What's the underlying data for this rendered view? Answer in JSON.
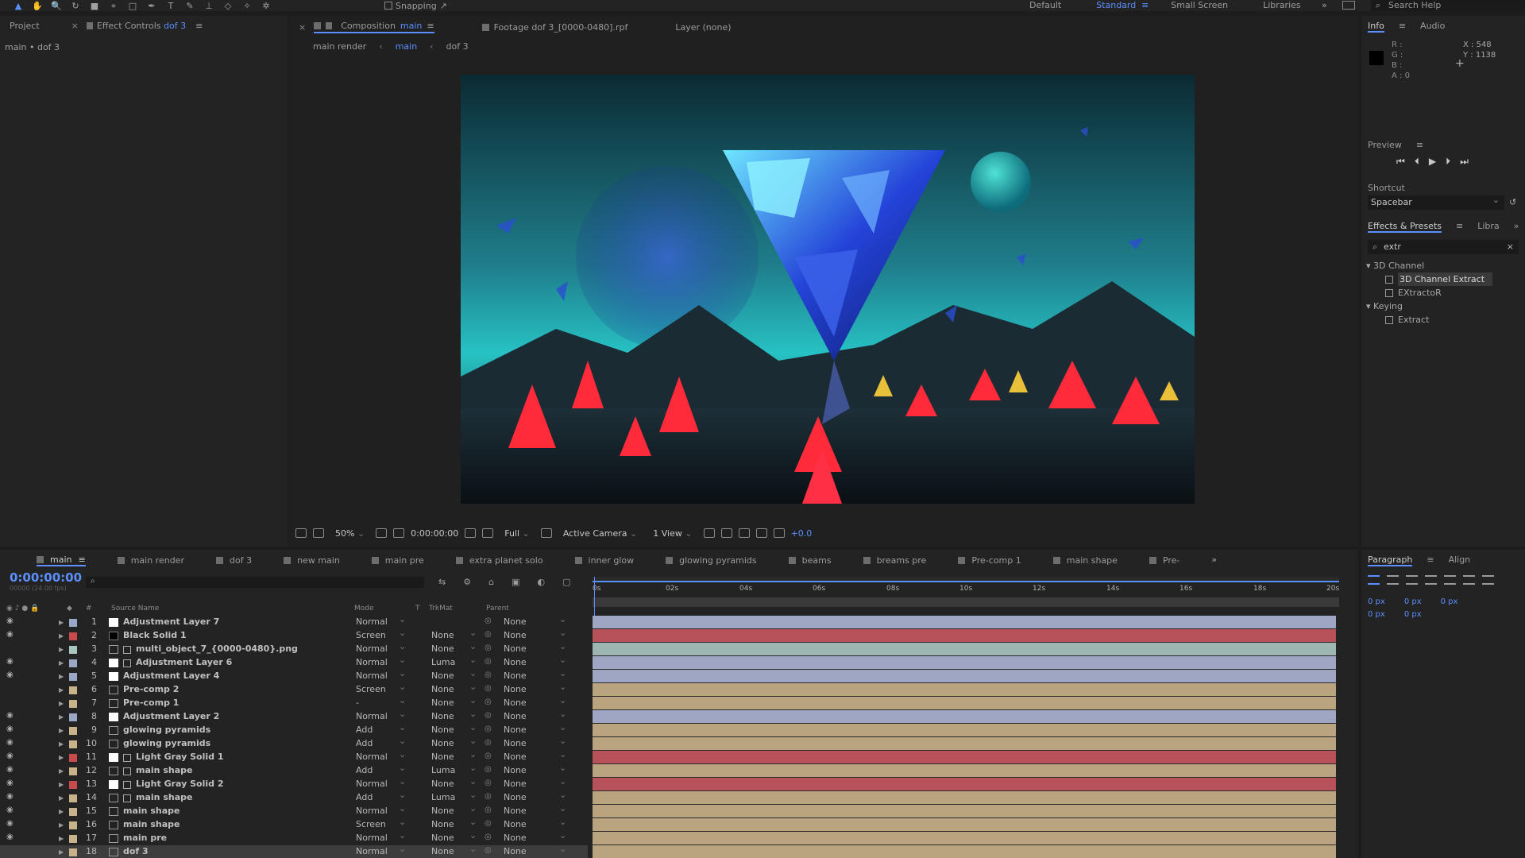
{
  "toolbar": {
    "snapping": "Snapping",
    "workspaces": [
      "Default",
      "Standard",
      "Small Screen",
      "Libraries"
    ],
    "active_workspace": "Standard",
    "search_placeholder": "Search Help"
  },
  "project_panel": {
    "tab_project": "Project",
    "tab_effect_controls": "Effect Controls",
    "effect_controls_target": "dof 3",
    "breadcrumb": "main • dof 3"
  },
  "composition": {
    "tab_label": "Composition",
    "tab_name": "main",
    "footage_tab": "Footage dof 3_[0000-0480].rpf",
    "layer_tab": "Layer (none)",
    "breadcrumb": [
      "main render",
      "main",
      "dof 3"
    ],
    "viewer": {
      "zoom": "50%",
      "time": "0:00:00:00",
      "resolution": "Full",
      "camera": "Active Camera",
      "views": "1 View",
      "exposure": "+0.0"
    }
  },
  "info_panel": {
    "tabs": [
      "Info",
      "Audio"
    ],
    "r": "R :",
    "g": "G :",
    "b": "B :",
    "a": "A : 0",
    "x": "X : 548",
    "y": "Y : 1138"
  },
  "preview_panel": {
    "title": "Preview",
    "shortcut_label": "Shortcut",
    "shortcut_value": "Spacebar"
  },
  "effects_panel": {
    "tabs": [
      "Effects & Presets",
      "Libra"
    ],
    "search": "extr",
    "groups": [
      {
        "name": "3D Channel",
        "items": [
          "3D Channel Extract",
          "EXtractoR"
        ]
      },
      {
        "name": "Keying",
        "items": [
          "Extract"
        ]
      }
    ],
    "selected_item": "3D Channel Extract"
  },
  "timeline": {
    "tabs": [
      "main",
      "main render",
      "dof 3",
      "new main",
      "main pre",
      "extra planet solo",
      "inner glow",
      "glowing pyramids",
      "beams",
      "breams pre",
      "Pre-comp 1",
      "main shape",
      "Pre-"
    ],
    "active_tab": "main",
    "timecode": "0:00:00:00",
    "timecode_sub": "00000 (24.00 fps)",
    "columns": {
      "num": "#",
      "source": "Source Name",
      "mode": "Mode",
      "t": "T",
      "trkmat": "TrkMat",
      "parent": "Parent"
    },
    "ruler_ticks": [
      "0s",
      "02s",
      "04s",
      "06s",
      "08s",
      "10s",
      "12s",
      "14s",
      "16s",
      "18s",
      "20s"
    ],
    "layers": [
      {
        "num": "1",
        "name": "Adjustment Layer 7",
        "mode": "Normal",
        "trkmat": "",
        "parent": "None",
        "label": "#9aa7c7",
        "icon": "solid",
        "fx": false,
        "eye": true,
        "bar": "#9fa6c4"
      },
      {
        "num": "2",
        "name": "Black Solid 1",
        "mode": "Screen",
        "trkmat": "None",
        "parent": "None",
        "label": "#c84a4a",
        "icon": "black",
        "fx": false,
        "eye": true,
        "bar": "#b8525a"
      },
      {
        "num": "3",
        "name": "multi_object_7_{0000-0480}.png",
        "mode": "Normal",
        "trkmat": "None",
        "parent": "None",
        "label": "#a9c5c1",
        "icon": "footage",
        "fx": true,
        "eye": false,
        "bar": "#9eb6b2"
      },
      {
        "num": "4",
        "name": "Adjustment Layer 6",
        "mode": "Normal",
        "trkmat": "Luma",
        "parent": "None",
        "label": "#9aa7c7",
        "icon": "solid",
        "fx": true,
        "eye": true,
        "bar": "#9fa6c4"
      },
      {
        "num": "5",
        "name": "Adjustment Layer 4",
        "mode": "Normal",
        "trkmat": "None",
        "parent": "None",
        "label": "#9aa7c7",
        "icon": "solid",
        "fx": false,
        "eye": true,
        "bar": "#9fa6c4"
      },
      {
        "num": "6",
        "name": "Pre-comp 2",
        "mode": "Screen",
        "trkmat": "None",
        "parent": "None",
        "label": "#c7b28a",
        "icon": "comp",
        "fx": false,
        "eye": false,
        "bar": "#b9a47f"
      },
      {
        "num": "7",
        "name": "Pre-comp 1",
        "mode": "-",
        "trkmat": "None",
        "parent": "None",
        "label": "#c7b28a",
        "icon": "comp",
        "fx": false,
        "eye": false,
        "bar": "#b9a47f"
      },
      {
        "num": "8",
        "name": "Adjustment Layer 2",
        "mode": "Normal",
        "trkmat": "None",
        "parent": "None",
        "label": "#9aa7c7",
        "icon": "solid",
        "fx": false,
        "eye": true,
        "bar": "#9fa6c4"
      },
      {
        "num": "9",
        "name": "glowing pyramids",
        "mode": "Add",
        "trkmat": "None",
        "parent": "None",
        "label": "#c7b28a",
        "icon": "comp",
        "fx": false,
        "eye": true,
        "bar": "#b9a47f"
      },
      {
        "num": "10",
        "name": "glowing pyramids",
        "mode": "Add",
        "trkmat": "None",
        "parent": "None",
        "label": "#c7b28a",
        "icon": "comp",
        "fx": false,
        "eye": true,
        "bar": "#b9a47f"
      },
      {
        "num": "11",
        "name": "Light Gray Solid 1",
        "mode": "Normal",
        "trkmat": "None",
        "parent": "None",
        "label": "#c84a4a",
        "icon": "solid",
        "fx": true,
        "eye": true,
        "bar": "#b8525a"
      },
      {
        "num": "12",
        "name": "main shape",
        "mode": "Add",
        "trkmat": "Luma",
        "parent": "None",
        "label": "#c7b28a",
        "icon": "comp",
        "fx": true,
        "eye": true,
        "bar": "#b9a47f"
      },
      {
        "num": "13",
        "name": "Light Gray Solid 2",
        "mode": "Normal",
        "trkmat": "None",
        "parent": "None",
        "label": "#c84a4a",
        "icon": "solid",
        "fx": true,
        "eye": true,
        "bar": "#b8525a"
      },
      {
        "num": "14",
        "name": "main shape",
        "mode": "Add",
        "trkmat": "Luma",
        "parent": "None",
        "label": "#c7b28a",
        "icon": "comp",
        "fx": true,
        "eye": true,
        "bar": "#b9a47f"
      },
      {
        "num": "15",
        "name": "main shape",
        "mode": "Normal",
        "trkmat": "None",
        "parent": "None",
        "label": "#c7b28a",
        "icon": "comp",
        "fx": false,
        "eye": true,
        "bar": "#b9a47f"
      },
      {
        "num": "16",
        "name": "main shape",
        "mode": "Screen",
        "trkmat": "None",
        "parent": "None",
        "label": "#c7b28a",
        "icon": "comp",
        "fx": false,
        "eye": true,
        "bar": "#b9a47f"
      },
      {
        "num": "17",
        "name": "main pre",
        "mode": "Normal",
        "trkmat": "None",
        "parent": "None",
        "label": "#c7b28a",
        "icon": "comp",
        "fx": false,
        "eye": true,
        "bar": "#b9a47f"
      },
      {
        "num": "18",
        "name": "dof 3",
        "mode": "Normal",
        "trkmat": "None",
        "parent": "None",
        "label": "#c7b28a",
        "icon": "comp",
        "fx": false,
        "eye": false,
        "bar": "#b9a47f",
        "selected": true
      }
    ]
  },
  "paragraph_panel": {
    "tabs": [
      "Paragraph",
      "Align"
    ],
    "indent_left": "0 px",
    "indent_first": "0 px",
    "indent_right": "0 px",
    "space_before": "0 px",
    "space_after": "0 px"
  },
  "colors": {
    "accent": "#5b8fff",
    "panel_bg": "#232323",
    "app_bg": "#1d1d1d"
  }
}
